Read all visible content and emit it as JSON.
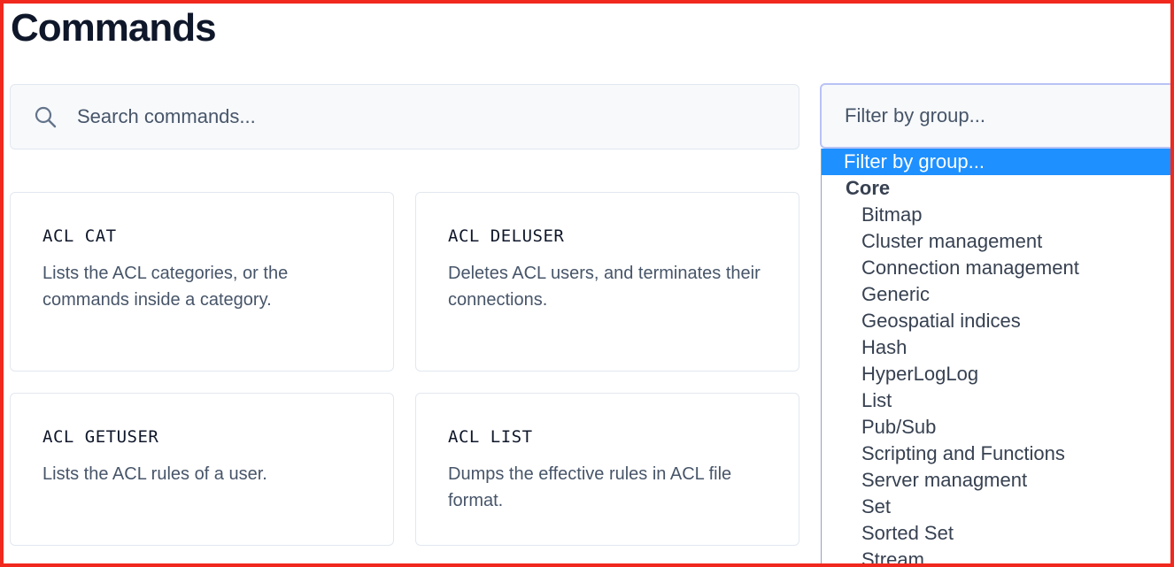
{
  "page": {
    "title": "Commands"
  },
  "search": {
    "placeholder": "Search commands..."
  },
  "filter": {
    "selected": "Filter by group...",
    "options": {
      "placeholder": "Filter by group...",
      "group_label": "Core",
      "items": [
        "Bitmap",
        "Cluster management",
        "Connection management",
        "Generic",
        "Geospatial indices",
        "Hash",
        "HyperLogLog",
        "List",
        "Pub/Sub",
        "Scripting and Functions",
        "Server managment",
        "Set",
        "Sorted Set",
        "Stream"
      ]
    }
  },
  "commands": [
    {
      "name": "ACL CAT",
      "description": "Lists the ACL categories, or the commands inside a category."
    },
    {
      "name": "ACL DELUSER",
      "description": "Deletes ACL users, and terminates their connections."
    },
    {
      "name": "ACL GETUSER",
      "description": "Lists the ACL rules of a user."
    },
    {
      "name": "ACL LIST",
      "description": "Dumps the effective rules in ACL file format."
    }
  ],
  "colors": {
    "highlight": "#1e90ff",
    "frame": "#f0281e"
  },
  "icons": {
    "search": "search-icon"
  }
}
